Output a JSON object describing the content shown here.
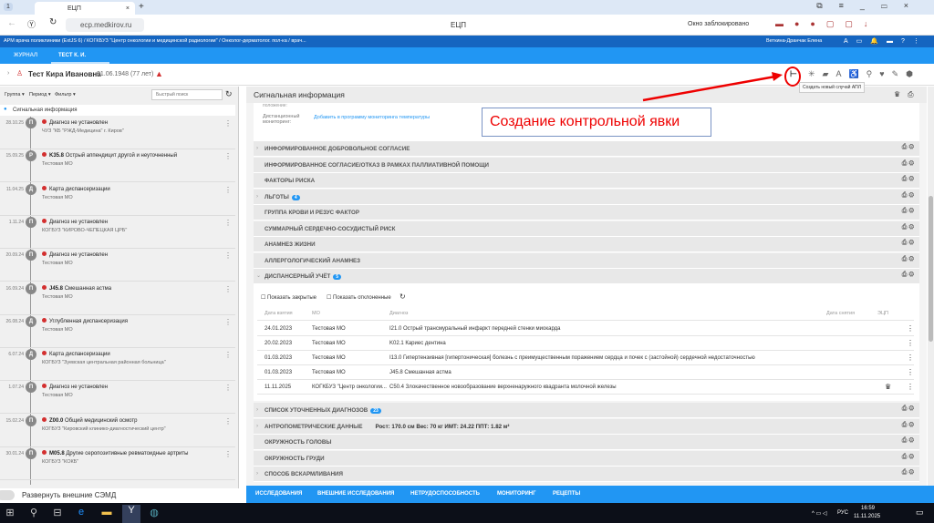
{
  "browser": {
    "tab_count": "1",
    "tab_title": "ЕЦП",
    "url": "ecp.medkirov.ru",
    "page_title": "ЕЦП",
    "popup_blocked": "Окно заблокировано"
  },
  "app": {
    "breadcrumb": "АРМ врача поликлиники (ExtJS 6) / КОГКБУЗ \"Центр онкологии и медицинской радиологии\" / Онколог-дерматолог. пол-ка / врач...",
    "user": "Веткина-Дранчак Елена",
    "tabs": [
      "ЖУРНАЛ",
      "ТЕСТ К. И."
    ]
  },
  "patient": {
    "name": "Тест Кира Ивановна",
    "dob": "01.06.1948 (77 лет)"
  },
  "toolbar": {
    "tooltip": "Создать новый случай АПЛ"
  },
  "annotation": {
    "label": "Создание контрольной явки"
  },
  "left": {
    "group": "Группа ▾",
    "period": "Период ▾",
    "filter": "Фильтр ▾",
    "search_placeholder": "Быстрый поиск",
    "signal": "Сигнальная информация",
    "toggle_label": "Развернуть внешние СЭМД",
    "items": [
      {
        "date": "28.10.25",
        "badge": "П",
        "code": "",
        "title": "Диагноз не установлен",
        "org": "ЧУЗ \"КБ \"РЖД-Медицина\" г. Киров\""
      },
      {
        "date": "15.09.25",
        "badge": "Р",
        "code": "K35.8",
        "title": "Острый аппендицит другой и неуточненный",
        "org": "Тестовая МО"
      },
      {
        "date": "11.04.25",
        "badge": "Д",
        "code": "",
        "title": "Карта диспансеризации",
        "org": "Тестовая МО"
      },
      {
        "date": "1.11.24",
        "badge": "П",
        "code": "",
        "title": "Диагноз не установлен",
        "org": "КОГБУЗ \"КИРОВО-ЧЕПЕЦКАЯ ЦРБ\""
      },
      {
        "date": "20.09.24",
        "badge": "П",
        "code": "",
        "title": "Диагноз не установлен",
        "org": "Тестовая МО"
      },
      {
        "date": "16.09.24",
        "badge": "П",
        "code": "J45.8",
        "title": "Смешанная астма",
        "org": "Тестовая МО"
      },
      {
        "date": "26.08.24",
        "badge": "Д",
        "code": "",
        "title": "Углубленная диспансеризация",
        "org": "Тестовая МО"
      },
      {
        "date": "6.07.24",
        "badge": "Д",
        "code": "",
        "title": "Карта диспансеризации",
        "org": "КОГБУЗ \"Зуевская центральная районная больница\""
      },
      {
        "date": "1.07.24",
        "badge": "П",
        "code": "",
        "title": "Диагноз не установлен",
        "org": "Тестовая МО"
      },
      {
        "date": "15.02.24",
        "badge": "П",
        "code": "Z00.0",
        "title": "Общий медицинский осмотр",
        "org": "КОГБУЗ \"Кировский клинико-диагностический центр\""
      },
      {
        "date": "30.01.24",
        "badge": "П",
        "code": "M05.8",
        "title": "Другие серопозитивные ревматоидные артриты",
        "org": "КОГБУЗ \"КОКБ\""
      }
    ]
  },
  "right": {
    "title": "Сигнальная информация",
    "partial_label": "положение:",
    "remote_label": "Дистанционный мониторинг:",
    "remote_link": "Добавить в программу мониторинга температуры",
    "sections_top": [
      {
        "label": "ИНФОРМИРОВАННОЕ ДОБРОВОЛЬНОЕ СОГЛАСИЕ",
        "chev": "›",
        "count": ""
      },
      {
        "label": "ИНФОРМИРОВАННОЕ СОГЛАСИЕ/ОТКАЗ В РАМКАХ ПАЛЛИАТИВНОЙ ПОМОЩИ",
        "chev": "",
        "count": ""
      },
      {
        "label": "ФАКТОРЫ РИСКА",
        "chev": "",
        "count": ""
      },
      {
        "label": "ЛЬГОТЫ",
        "chev": "›",
        "count": "4"
      },
      {
        "label": "ГРУППА КРОВИ И РЕЗУС ФАКТОР",
        "chev": "",
        "count": ""
      },
      {
        "label": "СУММАРНЫЙ СЕРДЕЧНО-СОСУДИСТЫЙ РИСК",
        "chev": "",
        "count": ""
      },
      {
        "label": "АНАМНЕЗ ЖИЗНИ",
        "chev": "",
        "count": ""
      },
      {
        "label": "АЛЛЕРГОЛОГИЧЕСКИЙ АНАМНЕЗ",
        "chev": "",
        "count": ""
      },
      {
        "label": "ДИСПАНСЕРНЫЙ УЧЁТ",
        "chev": "⌄",
        "count": "5"
      }
    ],
    "disp": {
      "show_closed": "Показать закрытые",
      "show_rejected": "Показать отклоненные",
      "columns": [
        "Дата взятия",
        "МО",
        "Диагноз",
        "Дата снятия",
        "ЭЦП"
      ],
      "rows": [
        {
          "date": "24.01.2023",
          "mo": "Тестовая МО",
          "diag": "I21.0 Острый трансмуральный инфаркт передней стенки миокарда"
        },
        {
          "date": "20.02.2023",
          "mo": "Тестовая МО",
          "diag": "K02.1 Кариес дентина"
        },
        {
          "date": "01.03.2023",
          "mo": "Тестовая МО",
          "diag": "I13.0 Гипертензивная [гипертоническая] болезнь с преимущественным поражением сердца и почек с (застойной) сердечной недостаточностью"
        },
        {
          "date": "01.03.2023",
          "mo": "Тестовая МО",
          "diag": "J45.8 Смешанная астма"
        },
        {
          "date": "11.11.2025",
          "mo": "КОГКБУЗ \"Центр онкологии...",
          "diag": "C50.4 Злокачественное новообразование верхненаружного квадранта молочной железы"
        }
      ]
    },
    "sections_bottom": [
      {
        "label": "СПИСОК УТОЧНЕННЫХ ДИАГНОЗОВ",
        "chev": "›",
        "count": "23"
      },
      {
        "label": "АНТРОПОМЕТРИЧЕСКИЕ ДАННЫЕ",
        "chev": "›",
        "count": ""
      },
      {
        "label": "ОКРУЖНОСТЬ ГОЛОВЫ",
        "chev": "",
        "count": ""
      },
      {
        "label": "ОКРУЖНОСТЬ ГРУДИ",
        "chev": "",
        "count": ""
      },
      {
        "label": "СПОСОБ ВСКАРМЛИВАНИЯ",
        "chev": "›",
        "count": ""
      }
    ],
    "anthro": "Рост: 170.0 см Вес: 70 кг ИМТ: 24.22 ППТ: 1.82 м²"
  },
  "bottom_tabs": [
    "ИССЛЕДОВАНИЯ",
    "ВНЕШНИЕ ИССЛЕДОВАНИЯ",
    "НЕТРУДОСПОСОБНОСТЬ",
    "МОНИТОРИНГ",
    "РЕЦЕПТЫ"
  ],
  "taskbar": {
    "lang": "РУС",
    "time": "16:59",
    "date": "11.11.2025"
  }
}
